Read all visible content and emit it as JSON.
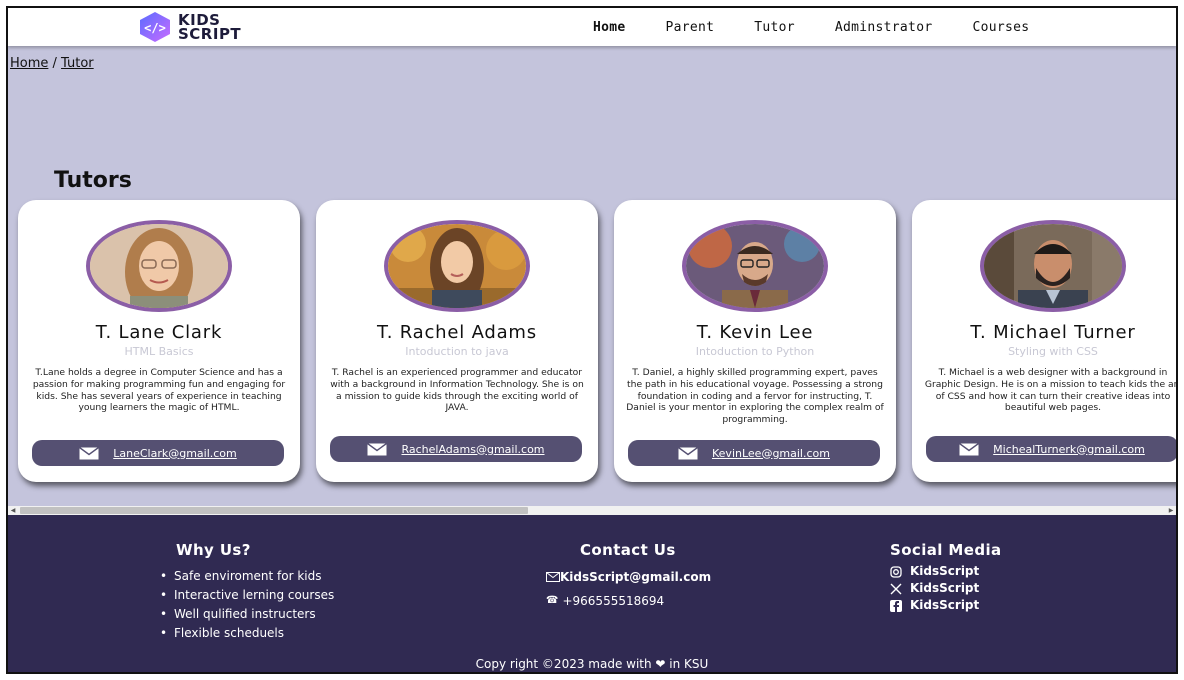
{
  "brand": {
    "line1": "KIDS",
    "line2": "SCRIPT",
    "colors": {
      "logo_gradient_from": "#6a5cff",
      "logo_gradient_to": "#c86bff"
    }
  },
  "nav": {
    "items": [
      "Home",
      "Parent",
      "Tutor",
      "Adminstrator",
      "Courses"
    ]
  },
  "breadcrumb": {
    "home": "Home",
    "separator": " / ",
    "current": "Tutor"
  },
  "page": {
    "heading": "Tutors"
  },
  "tutors": [
    {
      "name": "T. Lane Clark",
      "subject": "HTML Basics",
      "bio": "T.Lane holds a degree in Computer Science and has a passion for making programming fun and engaging for kids. She has several years of experience in teaching young learners the magic of HTML.",
      "email": "LaneClark@gmail.com",
      "photo": "woman-with-glasses-portrait"
    },
    {
      "name": "T. Rachel Adams",
      "subject": "Intoduction to java",
      "bio": "T. Rachel is an experienced programmer and educator with a background in Information Technology. She is on a mission to guide kids through the exciting world of JAVA.",
      "email": "RachelAdams@gmail.com",
      "photo": "woman-autumn-portrait"
    },
    {
      "name": "T. Kevin Lee",
      "subject": "Intoduction to Python",
      "bio": "T. Daniel, a highly skilled programming expert, paves the path in his educational voyage. Possessing a strong foundation in coding and a fervor for instructing, T. Daniel is your mentor in exploring the complex realm of programming.",
      "email": "KevinLee@gmail.com",
      "photo": "man-with-glasses-portrait"
    },
    {
      "name": "T. Michael Turner",
      "subject": "Styling with CSS",
      "bio": "T. Michael is a web designer with a background in Graphic Design. He is on a mission to teach kids the art of CSS and how it can turn their creative ideas into beautiful web pages.",
      "email": "MichealTurnerk@gmail.com",
      "photo": "man-bearded-portrait"
    }
  ],
  "footer": {
    "why_title": "Why Us?",
    "why_items": [
      "Safe enviroment for kids",
      "Interactive lerning courses",
      "Well qulified instructers",
      "Flexible scheduels"
    ],
    "contact_title": "Contact Us",
    "contact_email": "KidsScript@gmail.com",
    "contact_phone": "+966555518694",
    "social_title": "Social Media",
    "social": [
      {
        "icon": "instagram-icon",
        "label": "KidsScript"
      },
      {
        "icon": "x-twitter-icon",
        "label": "KidsScript"
      },
      {
        "icon": "facebook-icon",
        "label": "KidsScript"
      }
    ],
    "copyright": "Copy right ©2023 made with ❤ in KSU"
  },
  "colors": {
    "page_bg": "#c4c4dc",
    "card_border": "#8b5ea6",
    "email_pill": "#555072",
    "footer_bg": "#302a52"
  }
}
